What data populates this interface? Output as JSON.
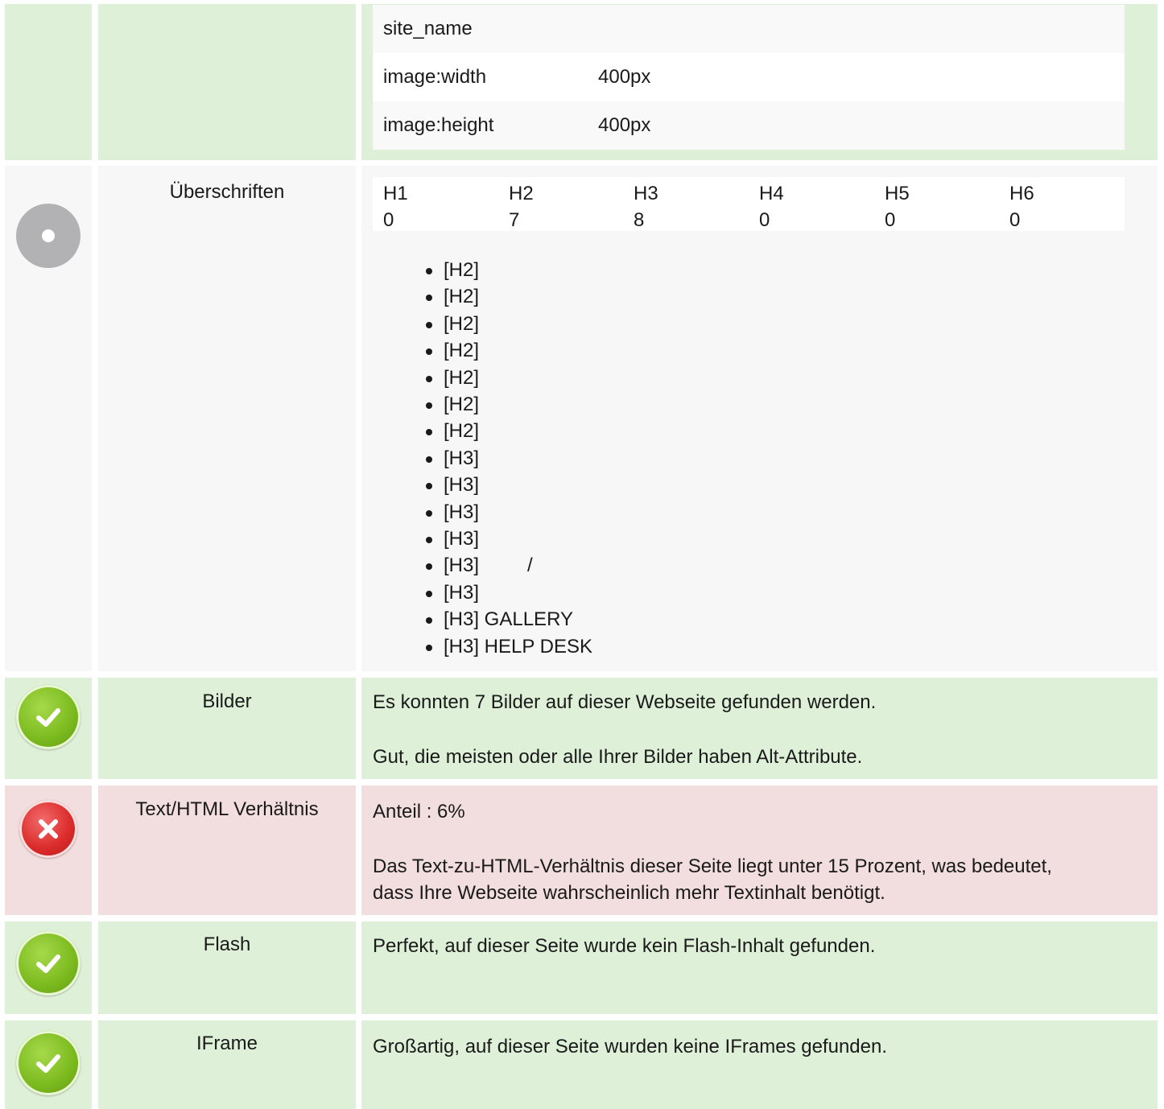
{
  "meta_tags": [
    {
      "key": "site_name",
      "value": ""
    },
    {
      "key": "image:width",
      "value": "400px"
    },
    {
      "key": "image:height",
      "value": "400px"
    }
  ],
  "headings": {
    "label": "Überschriften",
    "columns": [
      {
        "name": "H1",
        "count": "0"
      },
      {
        "name": "H2",
        "count": "7"
      },
      {
        "name": "H3",
        "count": "8"
      },
      {
        "name": "H4",
        "count": "0"
      },
      {
        "name": "H5",
        "count": "0"
      },
      {
        "name": "H6",
        "count": "0"
      }
    ],
    "list": [
      "[H2]",
      "[H2]",
      "[H2]",
      "[H2]",
      "[H2]",
      "[H2]",
      "[H2]",
      "[H3]",
      "[H3]",
      "[H3]",
      "[H3]",
      "[H3]         /",
      "[H3]",
      "[H3] GALLERY",
      "[H3] HELP DESK"
    ]
  },
  "checks": [
    {
      "label": "Bilder",
      "status": "ok",
      "lines": [
        "Es konnten 7 Bilder auf dieser Webseite gefunden werden.",
        "Gut, die meisten oder alle Ihrer Bilder haben Alt-Attribute."
      ]
    },
    {
      "label": "Text/HTML Verhältnis",
      "status": "error",
      "lines": [
        "Anteil : 6%",
        "Das Text-zu-HTML-Verhältnis dieser Seite liegt unter 15 Prozent, was bedeutet,",
        "dass Ihre Webseite wahrscheinlich mehr Textinhalt benötigt."
      ]
    },
    {
      "label": "Flash",
      "status": "ok",
      "lines": [
        "Perfekt, auf dieser Seite wurde kein Flash-Inhalt gefunden."
      ]
    },
    {
      "label": "IFrame",
      "status": "ok",
      "lines": [
        "Großartig, auf dieser Seite wurden keine IFrames gefunden."
      ]
    }
  ],
  "colors": {
    "ok_bg": "#dff0d8",
    "error_bg": "#f2dede",
    "neutral_bg": "#f7f7f7"
  },
  "icons": {
    "ok": "check-circle-icon",
    "error": "x-circle-icon",
    "info": "info-dot-icon"
  }
}
